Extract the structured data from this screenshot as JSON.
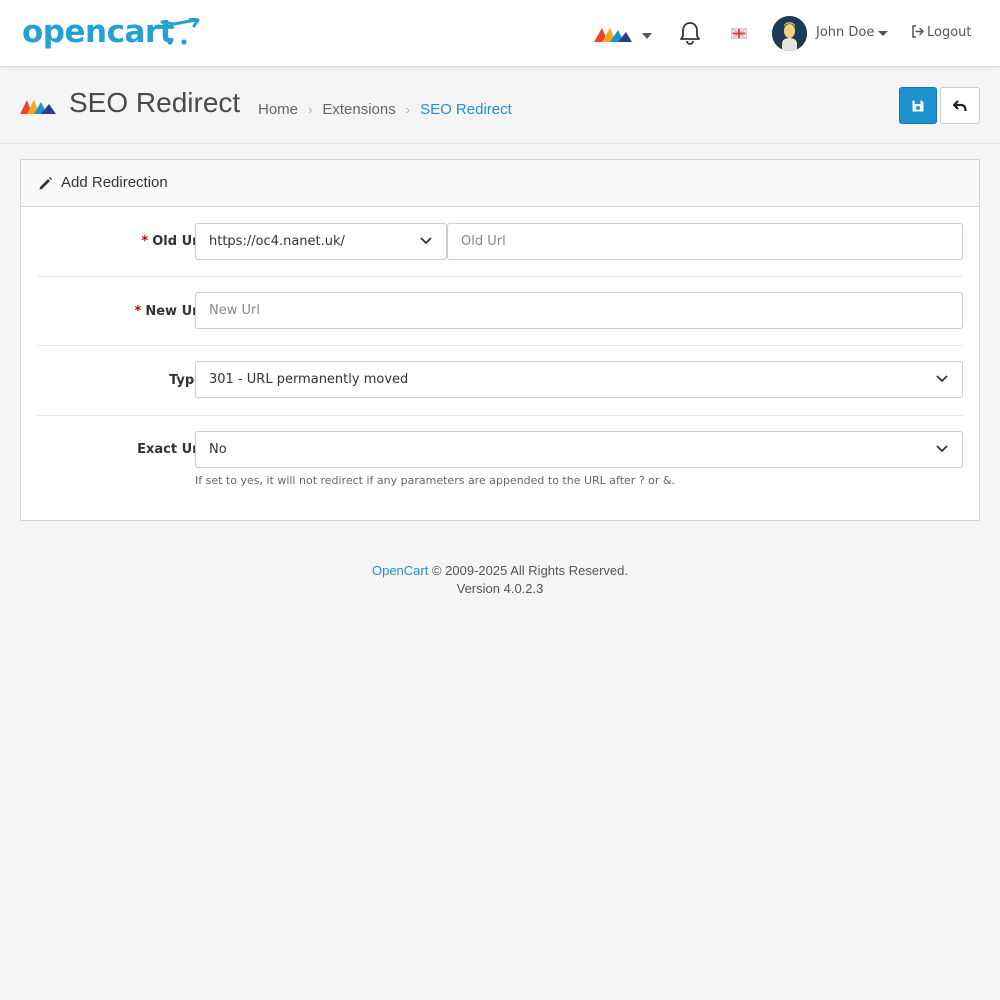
{
  "header": {
    "logo_text": "opencart",
    "user_name": "John Doe",
    "logout_label": "Logout",
    "icons": [
      "brand-switch-icon",
      "bell-icon",
      "uk-flag-icon",
      "avatar",
      "logout-icon"
    ]
  },
  "page": {
    "title": "SEO Redirect",
    "breadcrumb": [
      "Home",
      "Extensions",
      "SEO Redirect"
    ],
    "actions": {
      "save_icon": "save-icon",
      "back_icon": "back-arrow-icon"
    }
  },
  "form": {
    "panel_title": "Add Redirection",
    "old_url": {
      "label": "Old Url",
      "store_value": "https://oc4.nanet.uk/",
      "placeholder": "Old Url"
    },
    "new_url": {
      "label": "New Url",
      "placeholder": "New Url"
    },
    "type": {
      "label": "Type",
      "value": "301 - URL permanently moved"
    },
    "exact_url": {
      "label": "Exact Url",
      "value": "No",
      "help": "If set to yes, it will not redirect if any parameters are appended to the URL after ? or &."
    }
  },
  "footer": {
    "link": "OpenCart",
    "copyright": "© 2009-2025 All Rights Reserved.",
    "version": "Version 4.0.2.3"
  },
  "colors": {
    "accent": "#1e91cf",
    "logo": "#23a1d1",
    "required": "#cc0000",
    "background": "#f5f5f5"
  }
}
